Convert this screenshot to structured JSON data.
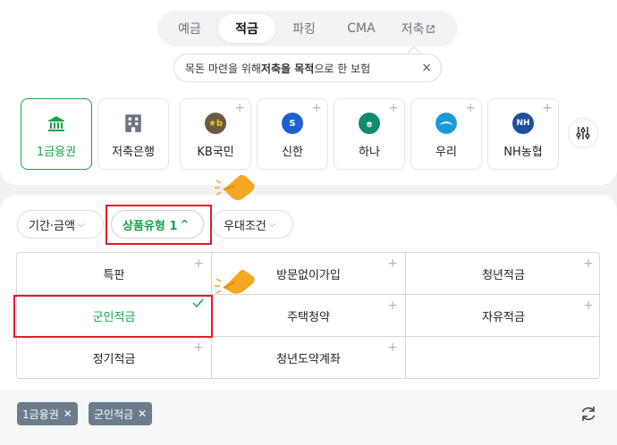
{
  "tabs": [
    {
      "label": "예금",
      "active": false
    },
    {
      "label": "적금",
      "active": true
    },
    {
      "label": "파킹",
      "active": false
    },
    {
      "label": "CMA",
      "active": false
    },
    {
      "label": "저축",
      "active": false
    }
  ],
  "tooltip": {
    "pre": "목돈 마련을 위해 ",
    "bold1": "저축을 목적",
    "post": "으로 한 보험",
    "close": "×"
  },
  "banks": [
    {
      "label": "1금융권",
      "icon": "bank-building-icon",
      "color": "#16a34a"
    },
    {
      "label": "저축은행",
      "icon": "office-building-icon",
      "color": "#6b7280"
    },
    {
      "label": "KB국민",
      "icon": "kb-logo-icon",
      "color": "#6b5a42"
    },
    {
      "label": "신한",
      "icon": "shinhan-logo-icon",
      "color": "#1f5fd1"
    },
    {
      "label": "하나",
      "icon": "hana-logo-icon",
      "color": "#0f8a70"
    },
    {
      "label": "우리",
      "icon": "woori-logo-icon",
      "color": "#1b9ad6"
    },
    {
      "label": "NH농협",
      "icon": "nh-logo-icon",
      "color": "#1c4fa0"
    }
  ],
  "bank_logo_text": {
    "kb": "★b",
    "shinhan": "S",
    "hana": "ㅎ",
    "nh": "NH"
  },
  "filters": [
    {
      "label": "기간·금액",
      "chev": "⌵"
    },
    {
      "label": "상품유형 1",
      "chev": "^"
    },
    {
      "label": "우대조건",
      "chev": "⌵"
    }
  ],
  "product_types": [
    [
      "특판",
      "방문없이가입",
      "청년적금"
    ],
    [
      "군인적금",
      "주택청약",
      "자유적금"
    ],
    [
      "정기적금",
      "청년도약계좌",
      ""
    ]
  ],
  "selected_chips": [
    {
      "label": "1금융권"
    },
    {
      "label": "군인적금"
    }
  ],
  "colors": {
    "accent": "#16a34a",
    "highlight": "#e11d2a",
    "chip": "#6b7d8c"
  }
}
